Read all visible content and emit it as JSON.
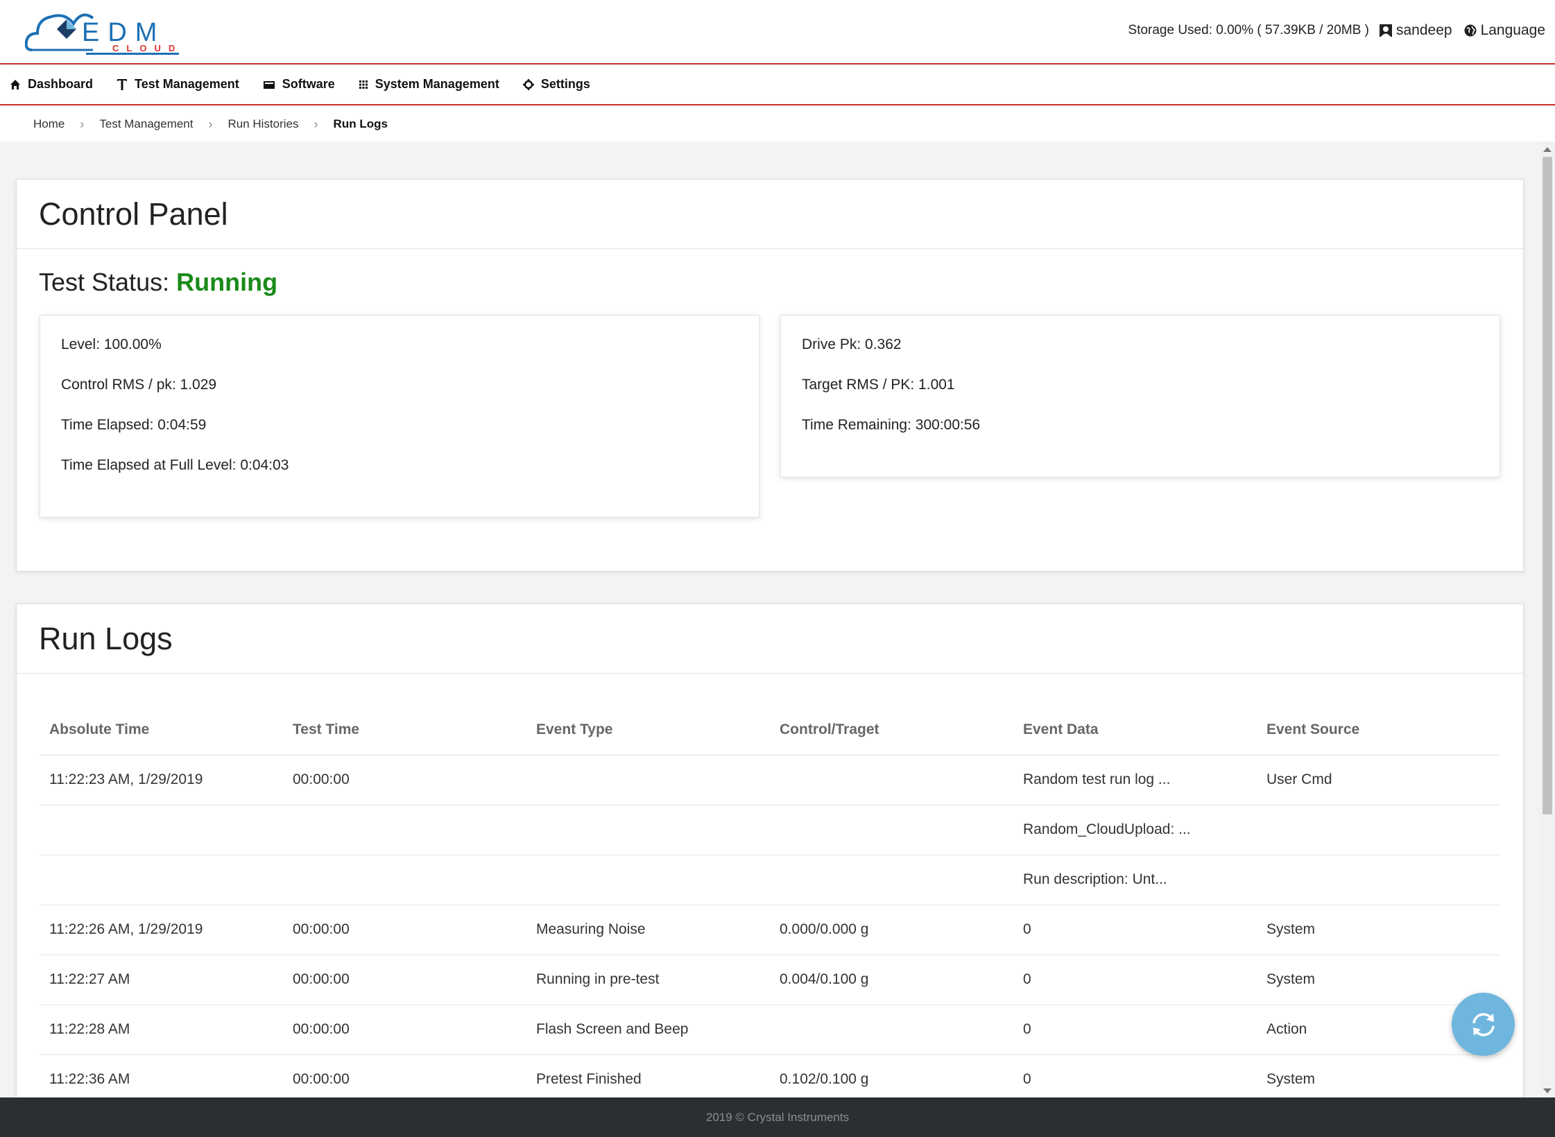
{
  "logo": {
    "primary": "EDM",
    "secondary": "CLOUD"
  },
  "header": {
    "storage": "Storage Used: 0.00% ( 57.39KB / 20MB )",
    "username": "sandeep",
    "language": "Language"
  },
  "nav": {
    "dashboard": "Dashboard",
    "test_management": "Test Management",
    "software": "Software",
    "system_management": "System Management",
    "settings": "Settings"
  },
  "breadcrumb": {
    "home": "Home",
    "test_management": "Test Management",
    "run_histories": "Run Histories",
    "run_logs": "Run Logs"
  },
  "control_panel": {
    "title": "Control Panel",
    "status_label": "Test Status:",
    "status_value": "Running",
    "left": {
      "level": "Level: 100.00%",
      "control_rms": "Control RMS / pk: 1.029",
      "time_elapsed": "Time Elapsed: 0:04:59",
      "time_elapsed_full": "Time Elapsed at Full Level: 0:04:03"
    },
    "right": {
      "drive_pk": "Drive Pk: 0.362",
      "target_rms": "Target RMS / PK: 1.001",
      "time_remaining": "Time Remaining: 300:00:56"
    }
  },
  "run_logs": {
    "title": "Run Logs",
    "columns": [
      "Absolute Time",
      "Test Time",
      "Event Type",
      "Control/Traget",
      "Event Data",
      "Event Source"
    ],
    "rows": [
      [
        "11:22:23 AM, 1/29/2019",
        "00:00:00",
        "",
        "",
        "Random test run log ...",
        "User Cmd"
      ],
      [
        "",
        "",
        "",
        "",
        "Random_CloudUpload: ...",
        ""
      ],
      [
        "",
        "",
        "",
        "",
        "Run description: Unt...",
        ""
      ],
      [
        "11:22:26 AM, 1/29/2019",
        "00:00:00",
        "Measuring Noise",
        "0.000/0.000 g",
        "0",
        "System"
      ],
      [
        "11:22:27 AM",
        "00:00:00",
        "Running in pre-test",
        "0.004/0.100 g",
        "0",
        "System"
      ],
      [
        "11:22:28 AM",
        "00:00:00",
        "Flash Screen and Beep",
        "",
        "0",
        "Action"
      ],
      [
        "11:22:36 AM",
        "00:00:00",
        "Pretest Finished",
        "0.102/0.100 g",
        "0",
        "System"
      ]
    ]
  },
  "footer": {
    "text": "2019 © Crystal Instruments"
  },
  "colors": {
    "accent_red": "#c9302c",
    "status_green": "#1a8a1a",
    "logo_blue": "#1b6fb5",
    "fab_blue": "#6fb6df"
  }
}
